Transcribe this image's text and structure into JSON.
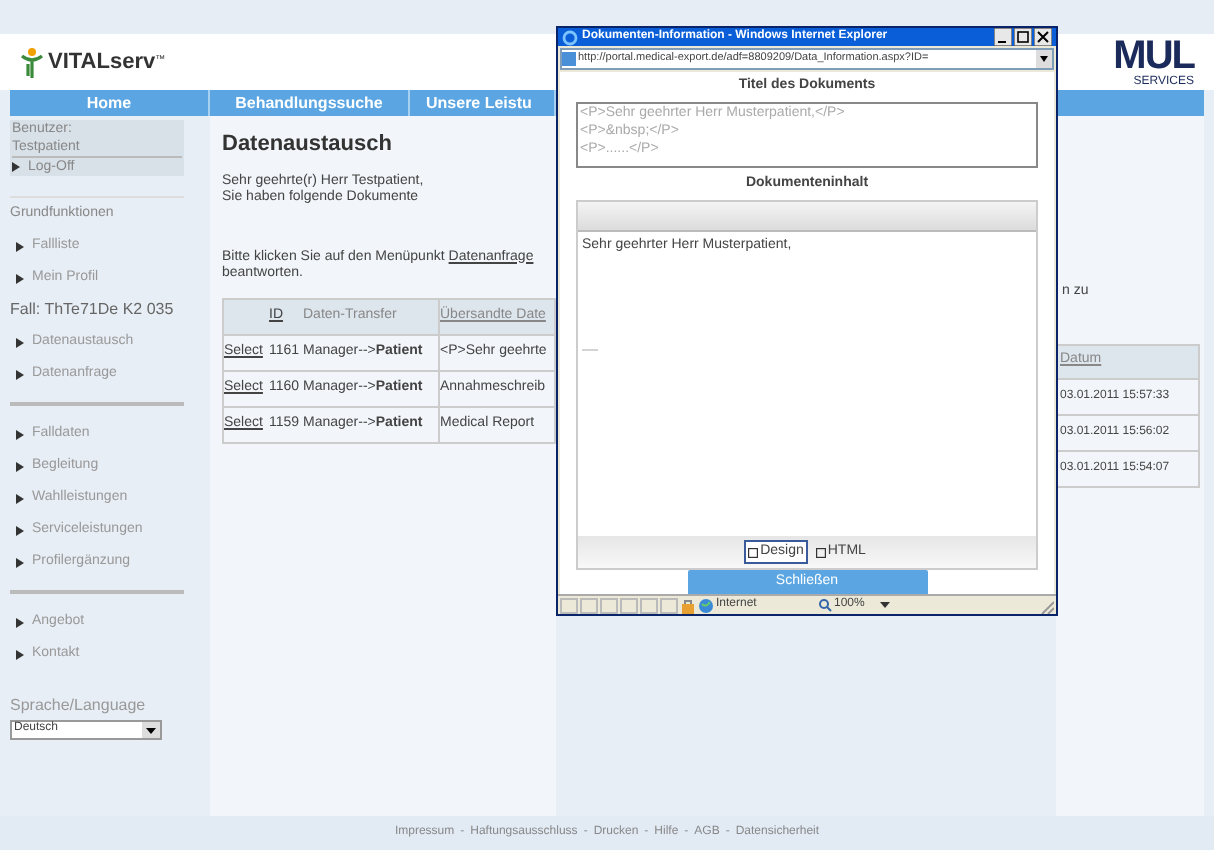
{
  "header": {
    "logo": "VITALserv",
    "logo_mark": "™",
    "partner_logo": "MUL",
    "partner_sub": "SERVICES"
  },
  "nav": [
    "Home",
    "Behandlungssuche",
    "Unsere Leistu"
  ],
  "sidebar": {
    "user_label": "Benutzer:",
    "user_name": "Testpatient",
    "logoff": "Log-Off",
    "groups": [
      [
        {
          "kind": "heading",
          "label": "Grundfunktionen"
        },
        {
          "kind": "link",
          "label": "Fallliste"
        },
        {
          "kind": "link",
          "label": "Mein Profil"
        },
        {
          "kind": "case",
          "label": "Fall: ThTe71De K2 035"
        },
        {
          "kind": "link",
          "label": "Datenaustausch"
        },
        {
          "kind": "link",
          "label": "Datenanfrage"
        }
      ],
      [
        {
          "kind": "link",
          "label": "Falldaten"
        },
        {
          "kind": "link",
          "label": "Begleitung"
        },
        {
          "kind": "link",
          "label": "Wahlleistungen"
        },
        {
          "kind": "link",
          "label": "Serviceleistungen"
        },
        {
          "kind": "link",
          "label": "Profilergänzung"
        }
      ],
      [
        {
          "kind": "link",
          "label": "Angebot"
        },
        {
          "kind": "link",
          "label": "Kontakt"
        }
      ]
    ],
    "language_label": "Sprache/Language",
    "language_value": "Deutsch"
  },
  "content": {
    "title": "Datenaustausch",
    "greeting": "Sehr geehrte(r) Herr Testpatient,",
    "intro": "Sie haben folgende Dokumente",
    "instruction": "Bitte klicken Sie auf den Menüpunkt",
    "instruction_link": "Datenanfrage",
    "instruction_tail": "n zu",
    "instruction_end": "beantworten.",
    "table": {
      "columns": [
        "ID",
        "Daten-Transfer",
        "Übersandte Date",
        "Datum"
      ],
      "rows": [
        {
          "action": "Select",
          "id": "1161",
          "from": "Manager-->",
          "to": "Patient",
          "title": "<P>Sehr geehrte",
          "date": "03.01.2011 15:57:33"
        },
        {
          "action": "Select",
          "id": "1160",
          "from": "Manager-->",
          "to": "Patient",
          "title": "Annahmeschreib",
          "date": "03.01.2011 15:56:02"
        },
        {
          "action": "Select",
          "id": "1159",
          "from": "Manager-->",
          "to": "Patient",
          "title": "Medical Report",
          "date": "03.01.2011 15:54:07"
        }
      ]
    }
  },
  "footer": [
    "Impressum",
    "Haftungsausschluss",
    "Drucken",
    "Hilfe",
    "AGB",
    "Datensicherheit"
  ],
  "footer_separator": "-",
  "popup": {
    "title": "Dokumenten-Information - Windows Internet Explorer",
    "url": "http://portal.medical-export.de/adf=8809209/Data_Information.aspx?ID=",
    "title_heading": "Titel des Dokuments",
    "title_lines": [
      "<P>Sehr geehrter Herr Musterpatient,</P>",
      "<P>&nbsp;</P>",
      "<P>......</P>"
    ],
    "content_heading": "Dokumenteninhalt",
    "content_text": "Sehr geehrter Herr Musterpatient,",
    "modes": [
      {
        "label": "Design",
        "selected": true
      },
      {
        "label": "HTML",
        "selected": false
      }
    ],
    "close_button": "Schließen",
    "status_zone": "Internet",
    "zoom": "100%"
  }
}
